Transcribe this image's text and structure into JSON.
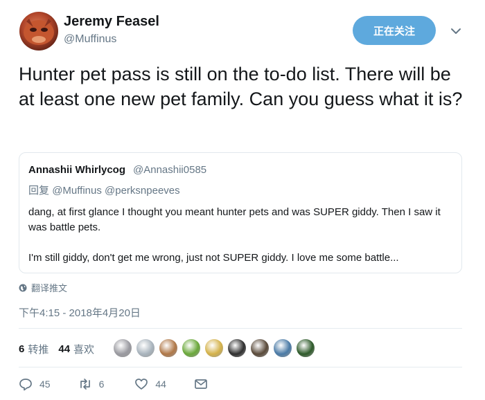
{
  "author": {
    "name": "Jeremy Feasel",
    "handle": "@Muffinus"
  },
  "follow_button_label": "正在关注",
  "tweet_text": "Hunter pet pass is still on the to-do list. There will be at least one new pet family. Can you guess what it is?",
  "quoted": {
    "name": "Annashii Whirlycog",
    "handle": "@Annashii0585",
    "reply_prefix": "回复",
    "reply_to_1": "@Muffinus",
    "reply_to_2": "@perksnpeeves",
    "body_line_1": "dang, at first glance I thought you meant hunter pets and was SUPER giddy. Then I saw it was battle pets.",
    "body_line_2": "I'm still giddy, don't get me wrong, just not SUPER giddy. I love me some battle..."
  },
  "translate_label": "翻译推文",
  "timestamp": "下午4:15 - 2018年4月20日",
  "stats": {
    "retweets_count": "6",
    "retweets_label": "转推",
    "likes_count": "44",
    "likes_label": "喜欢"
  },
  "liker_avatars": [
    {
      "color": "#9a9aa0"
    },
    {
      "color": "#a9b4bd"
    },
    {
      "color": "#b07848"
    },
    {
      "color": "#6aa83a"
    },
    {
      "color": "#d4b24a"
    },
    {
      "color": "#2f2f2f"
    },
    {
      "color": "#5a4a3a"
    },
    {
      "color": "#4a7aa6"
    },
    {
      "color": "#2e5a2a"
    }
  ],
  "actions": {
    "reply_count": "45",
    "retweet_count": "6",
    "like_count": "44"
  },
  "colors": {
    "follow_button": "#5ea9dd",
    "secondary_text": "#657786",
    "border": "#e1e8ed"
  }
}
